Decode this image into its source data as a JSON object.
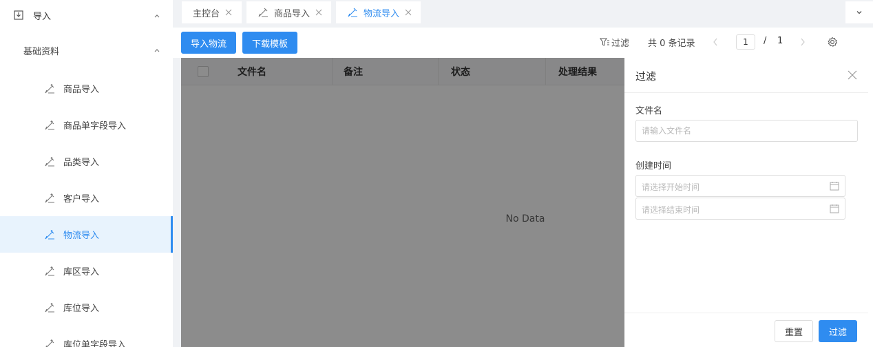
{
  "sidebar": {
    "top": {
      "label": "导入",
      "icon": "import-icon"
    },
    "group": {
      "label": "基础资料"
    },
    "items": [
      {
        "label": "商品导入"
      },
      {
        "label": "商品单字段导入"
      },
      {
        "label": "品类导入"
      },
      {
        "label": "客户导入"
      },
      {
        "label": "物流导入",
        "active": true
      },
      {
        "label": "库区导入"
      },
      {
        "label": "库位导入"
      },
      {
        "label": "库位单字段导入"
      }
    ]
  },
  "tabs": [
    {
      "label": "主控台"
    },
    {
      "label": "商品导入"
    },
    {
      "label": "物流导入",
      "active": true
    }
  ],
  "toolbar": {
    "import_btn": "导入物流",
    "download_btn": "下载模板",
    "filter_label": "过滤",
    "total": "共 0 条记录",
    "page_current": "1",
    "page_sep": "/",
    "page_total": "1"
  },
  "table": {
    "columns": [
      "文件名",
      "备注",
      "状态",
      "处理结果"
    ],
    "empty_text": "No Data"
  },
  "drawer": {
    "title": "过滤",
    "filename_label": "文件名",
    "filename_placeholder": "请输入文件名",
    "created_label": "创建时间",
    "start_placeholder": "请选择开始时间",
    "end_placeholder": "请选择结束时间",
    "reset_btn": "重置",
    "filter_btn": "过滤"
  },
  "colors": {
    "primary": "#2f8cf0",
    "active_bg": "#e8f3fd"
  }
}
